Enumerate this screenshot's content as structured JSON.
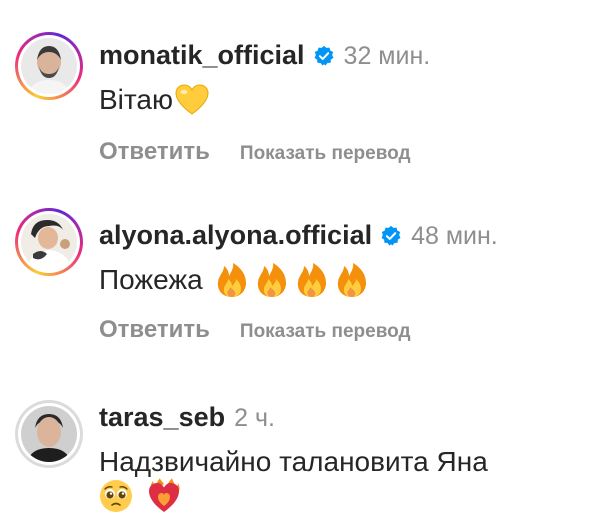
{
  "comments": [
    {
      "username": "monatik_official",
      "verified": true,
      "time": "32 мин.",
      "text": "Вітаю",
      "emojis": [
        "yellow-heart"
      ],
      "reply_label": "Ответить",
      "translate_label": "Показать перевод"
    },
    {
      "username": "alyona.alyona.official",
      "verified": true,
      "time": "48 мин.",
      "text": "Пожежа",
      "emojis": [
        "fire",
        "fire",
        "fire",
        "fire"
      ],
      "reply_label": "Ответить",
      "translate_label": "Показать перевод"
    },
    {
      "username": "taras_seb",
      "verified": false,
      "time": "2 ч.",
      "text": "Надзвичайно талановита Яна",
      "emojis": [
        "pleading-face",
        "heart-on-fire"
      ]
    }
  ],
  "colors": {
    "text": "#262626",
    "secondary": "#8e8e8e",
    "verified": "#0095f6"
  }
}
